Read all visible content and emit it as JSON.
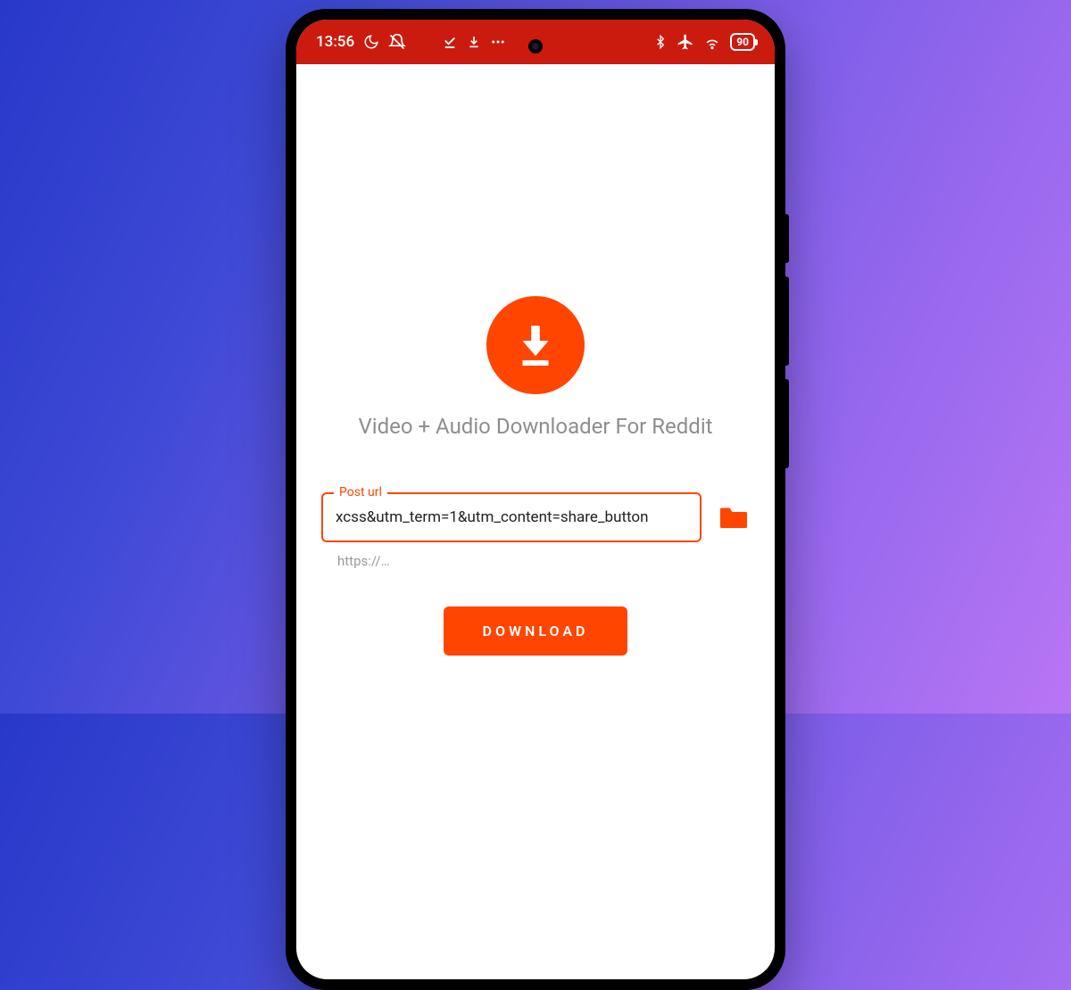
{
  "statusbar": {
    "time": "13:56",
    "battery": "90"
  },
  "app": {
    "title": "Video + Audio Downloader For Reddit",
    "url_field_label": "Post url",
    "url_value": "xcss&utm_term=1&utm_content=share_button",
    "hint": "https://…",
    "download_label": "DOWNLOAD"
  },
  "colors": {
    "accent": "#ff4500",
    "statusbar": "#cb1b0f"
  }
}
